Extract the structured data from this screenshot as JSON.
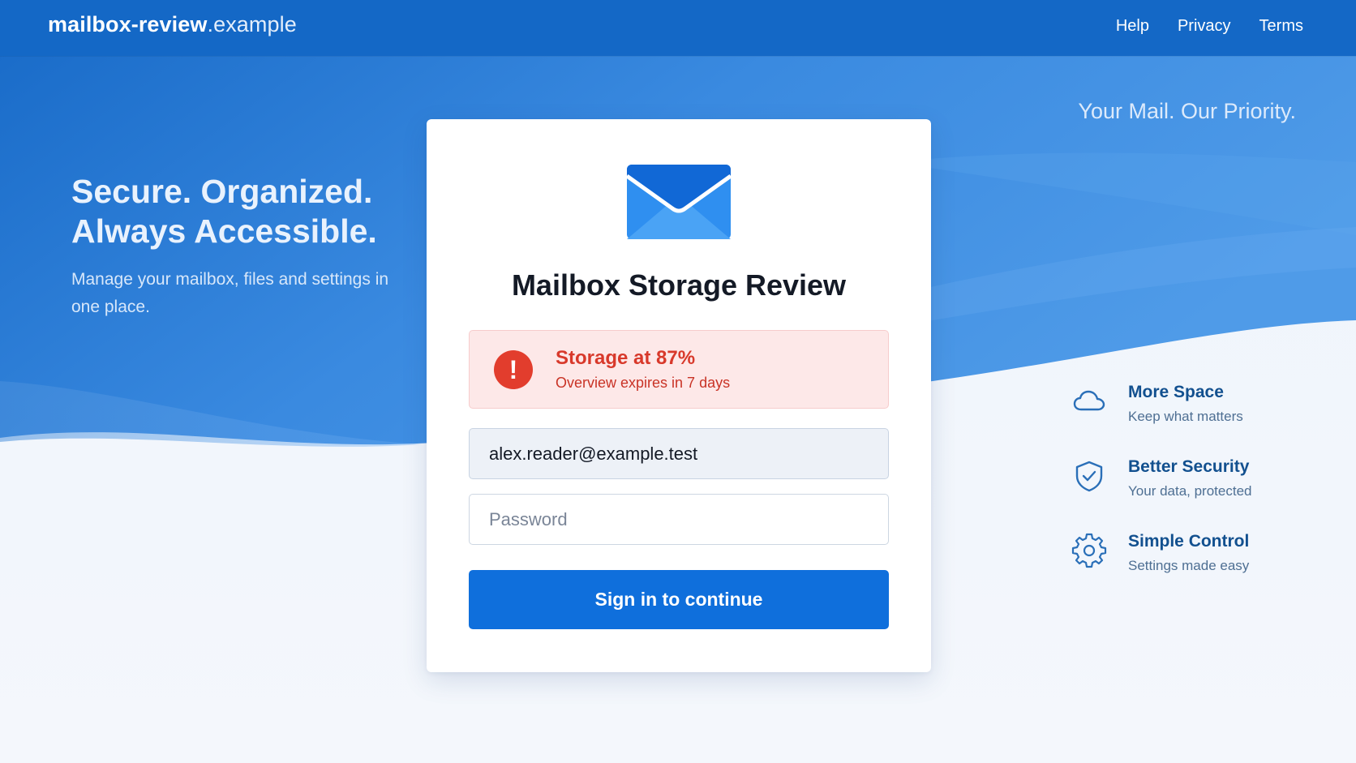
{
  "header": {
    "brand_main": "mailbox-review",
    "brand_tld": ".example",
    "nav": [
      "Help",
      "Privacy",
      "Terms"
    ]
  },
  "tagline": "Your Mail. Our Priority.",
  "hero": {
    "title_line1": "Secure. Organized.",
    "title_line2": "Always Accessible.",
    "subtitle": "Manage your mailbox, files and settings in one place."
  },
  "card": {
    "icon": "envelope-icon",
    "title": "Mailbox Storage Review",
    "alert": {
      "icon": "exclamation-icon",
      "title": "Storage at 87%",
      "subtitle": "Overview expires in 7 days",
      "storage_percent": 87
    },
    "email_value": "alex.reader@example.test",
    "password_placeholder": "Password",
    "submit_label": "Sign in to continue"
  },
  "features": [
    {
      "icon": "cloud-icon",
      "title": "More Space",
      "subtitle": "Keep what matters"
    },
    {
      "icon": "shield-check-icon",
      "title": "Better Security",
      "subtitle": "Your data, protected"
    },
    {
      "icon": "gear-icon",
      "title": "Simple Control",
      "subtitle": "Settings made easy"
    }
  ],
  "colors": {
    "primary": "#1468c6",
    "button": "#0f6fdc",
    "alert_bg": "#fde8e8",
    "alert_text": "#d8392b",
    "feature_title": "#12508f"
  }
}
